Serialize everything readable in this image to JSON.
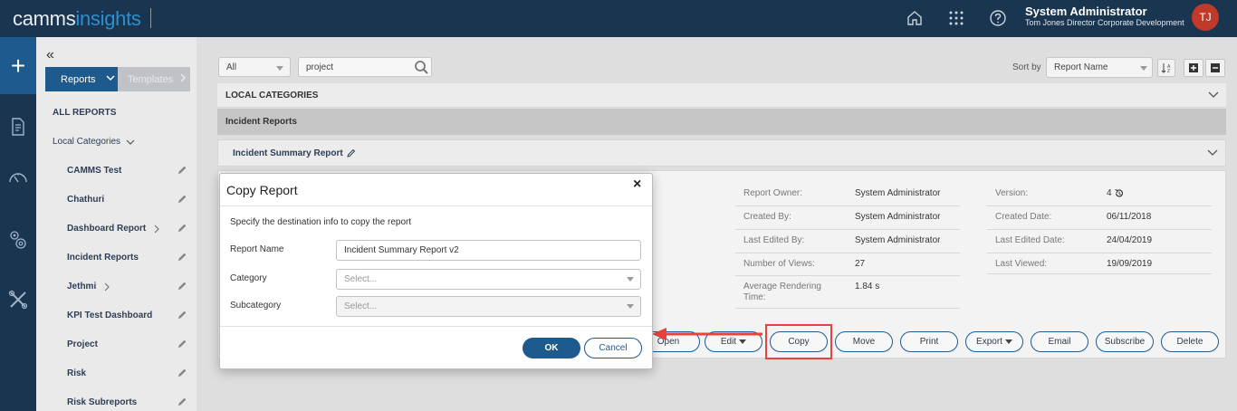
{
  "brand": {
    "part1": "camms",
    "part2": "insights"
  },
  "user": {
    "name": "System Administrator",
    "subtitle": "Tom Jones Director Corporate Development",
    "initials": "TJ"
  },
  "topbar_icons": [
    "home-icon",
    "apps-grid-icon",
    "help-icon"
  ],
  "rail_icons": [
    "plus-icon",
    "report-document-icon",
    "speedometer-icon",
    "settings-gears-icon",
    "tools-icon"
  ],
  "sidebar": {
    "tabs": {
      "reports": "Reports",
      "templates": "Templates"
    },
    "all_reports": "ALL REPORTS",
    "local_categories": "Local Categories",
    "items": [
      {
        "label": "CAMMS Test",
        "has_children": false
      },
      {
        "label": "Chathuri",
        "has_children": false
      },
      {
        "label": "Dashboard Report",
        "has_children": true
      },
      {
        "label": "Incident Reports",
        "has_children": false
      },
      {
        "label": "Jethmi",
        "has_children": true
      },
      {
        "label": "KPI Test Dashboard",
        "has_children": false
      },
      {
        "label": "Project",
        "has_children": false
      },
      {
        "label": "Risk",
        "has_children": false
      },
      {
        "label": "Risk Subreports",
        "has_children": false
      }
    ]
  },
  "filter": {
    "scope": "All",
    "search_value": "project",
    "sort_label": "Sort by",
    "sort_value": "Report Name"
  },
  "list": {
    "section": "LOCAL CATEGORIES",
    "category": "Incident Reports",
    "report": "Incident Summary Report"
  },
  "details": {
    "left": [
      {
        "label": "Report Owner:",
        "value": "System Administrator"
      },
      {
        "label": "Created By:",
        "value": "System Administrator"
      },
      {
        "label": "Last Edited By:",
        "value": "System Administrator"
      },
      {
        "label": "Number of Views:",
        "value": "27"
      },
      {
        "label": "Average Rendering Time:",
        "value": "1.84 s"
      }
    ],
    "right": [
      {
        "label": "Version:",
        "value": "4"
      },
      {
        "label": "Created Date:",
        "value": "06/11/2018"
      },
      {
        "label": "Last Edited Date:",
        "value": "24/04/2019"
      },
      {
        "label": "Last Viewed:",
        "value": "19/09/2019"
      }
    ]
  },
  "actions": {
    "open": "Open",
    "edit": "Edit",
    "copy": "Copy",
    "move": "Move",
    "print": "Print",
    "export": "Export",
    "email": "Email",
    "subscribe": "Subscribe",
    "delete": "Delete"
  },
  "modal": {
    "title": "Copy Report",
    "close": "×",
    "instruction": "Specify the destination info to copy the  report",
    "report_name_label": "Report Name",
    "report_name_value": "Incident Summary Report v2",
    "category_label": "Category",
    "category_value": "Select...",
    "subcategory_label": "Subcategory",
    "subcategory_value": "Select...",
    "ok": "OK",
    "cancel": "Cancel"
  },
  "colors": {
    "topbar": "#1a3550",
    "primary": "#1d5a8d",
    "accent": "#2b8fd0",
    "highlight": "#e8423e",
    "avatar": "#c0392b"
  }
}
